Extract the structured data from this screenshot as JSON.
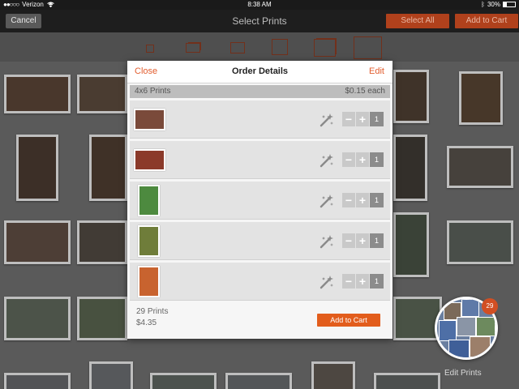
{
  "status_bar": {
    "carrier": "Verizon",
    "time": "8:38 AM",
    "battery_percent": "30%",
    "battery_level": 0.3
  },
  "nav": {
    "cancel_label": "Cancel",
    "title": "Select Prints",
    "select_all_label": "Select All",
    "add_to_cart_label": "Add to Cart"
  },
  "modal": {
    "close_label": "Close",
    "title": "Order Details",
    "edit_label": "Edit",
    "group": {
      "size": "4x6 Prints",
      "price": "$0.15 each"
    },
    "items": [
      {
        "quantity": "1",
        "orientation": "landscape",
        "color": "#7a4a3a"
      },
      {
        "quantity": "1",
        "orientation": "landscape",
        "color": "#8b3a2a"
      },
      {
        "quantity": "1",
        "orientation": "portrait",
        "color": "#4d8a3f"
      },
      {
        "quantity": "1",
        "orientation": "portrait",
        "color": "#6f7d3a"
      },
      {
        "quantity": "1",
        "orientation": "portrait",
        "color": "#c8632f"
      }
    ],
    "minus_symbol": "−",
    "plus_symbol": "+",
    "footer": {
      "count": "29 Prints",
      "total": "$4.35",
      "add_to_cart_label": "Add to Cart"
    }
  },
  "edit_prints": {
    "badge_count": "29",
    "label": "Edit Prints"
  },
  "colors": {
    "accent": "#e25d2e",
    "nav_button": "#b0411c"
  }
}
